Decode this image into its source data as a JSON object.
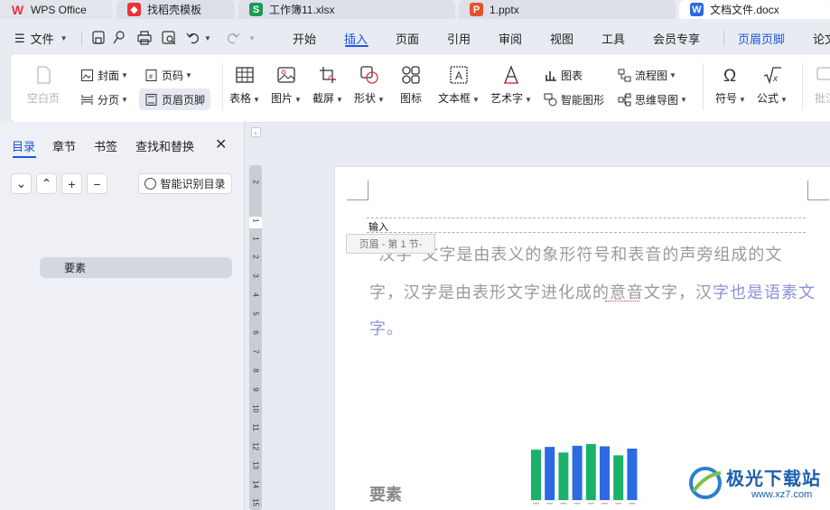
{
  "tabs": [
    {
      "label": "WPS Office",
      "icon": "wps-logo-icon",
      "color": "#e8323c"
    },
    {
      "label": "找稻壳模板",
      "icon": "docer-logo-icon",
      "color": "#e8323c"
    },
    {
      "label": "工作簿11.xlsx",
      "icon": "spreadsheet-icon",
      "color": "#1f9a55"
    },
    {
      "label": "1.pptx",
      "icon": "presentation-icon",
      "color": "#e4512f"
    },
    {
      "label": "文档文件.docx",
      "icon": "document-icon",
      "color": "#2b6ae0"
    }
  ],
  "menu": {
    "file": "文件",
    "items": [
      "开始",
      "插入",
      "页面",
      "引用",
      "审阅",
      "视图",
      "工具",
      "会员专享",
      "页眉页脚",
      "论文"
    ],
    "active": "插入"
  },
  "ribbon": {
    "blank_page": "空白页",
    "cover": "封面",
    "page_num": "页码",
    "page_break": "分页",
    "header_footer": "页眉页脚",
    "table": "表格",
    "picture": "图片",
    "screenshot": "截屏",
    "shape": "形状",
    "icons": "图标",
    "textbox": "文本框",
    "wordart": "艺术字",
    "chart": "图表",
    "smartart": "智能图形",
    "flowchart": "流程图",
    "mindmap": "思维导图",
    "symbol": "符号",
    "formula": "公式",
    "comment": "批注"
  },
  "panel": {
    "tabs": [
      "目录",
      "章节",
      "书签",
      "查找和替换"
    ],
    "active_tab": "目录",
    "smart_toc": "智能识别目录",
    "toc_items": [
      "要素"
    ]
  },
  "ruler": [
    "2",
    "1",
    "1",
    "2",
    "3",
    "4",
    "5",
    "6",
    "7",
    "8",
    "9",
    "10",
    "11",
    "12",
    "13",
    "14",
    "15"
  ],
  "document": {
    "header_text": "输入",
    "header_tag": "页眉 - 第 1 节-",
    "line1": "“汉字”文字是由表义的象形符号和表音的声旁组成的文",
    "line2a": "字，汉字是由表形文字进化成的意音文字，汉",
    "line2b": "字也是语素文",
    "line3": "字。",
    "heading": "要素"
  },
  "chart_data": {
    "type": "bar",
    "values": [
      90,
      95,
      85,
      97,
      100,
      96,
      80,
      92
    ],
    "colors": [
      "#1ab26b",
      "#2b6ae0"
    ]
  },
  "watermark": {
    "line1": "极光下载站",
    "line2": "www.xz7.com"
  }
}
